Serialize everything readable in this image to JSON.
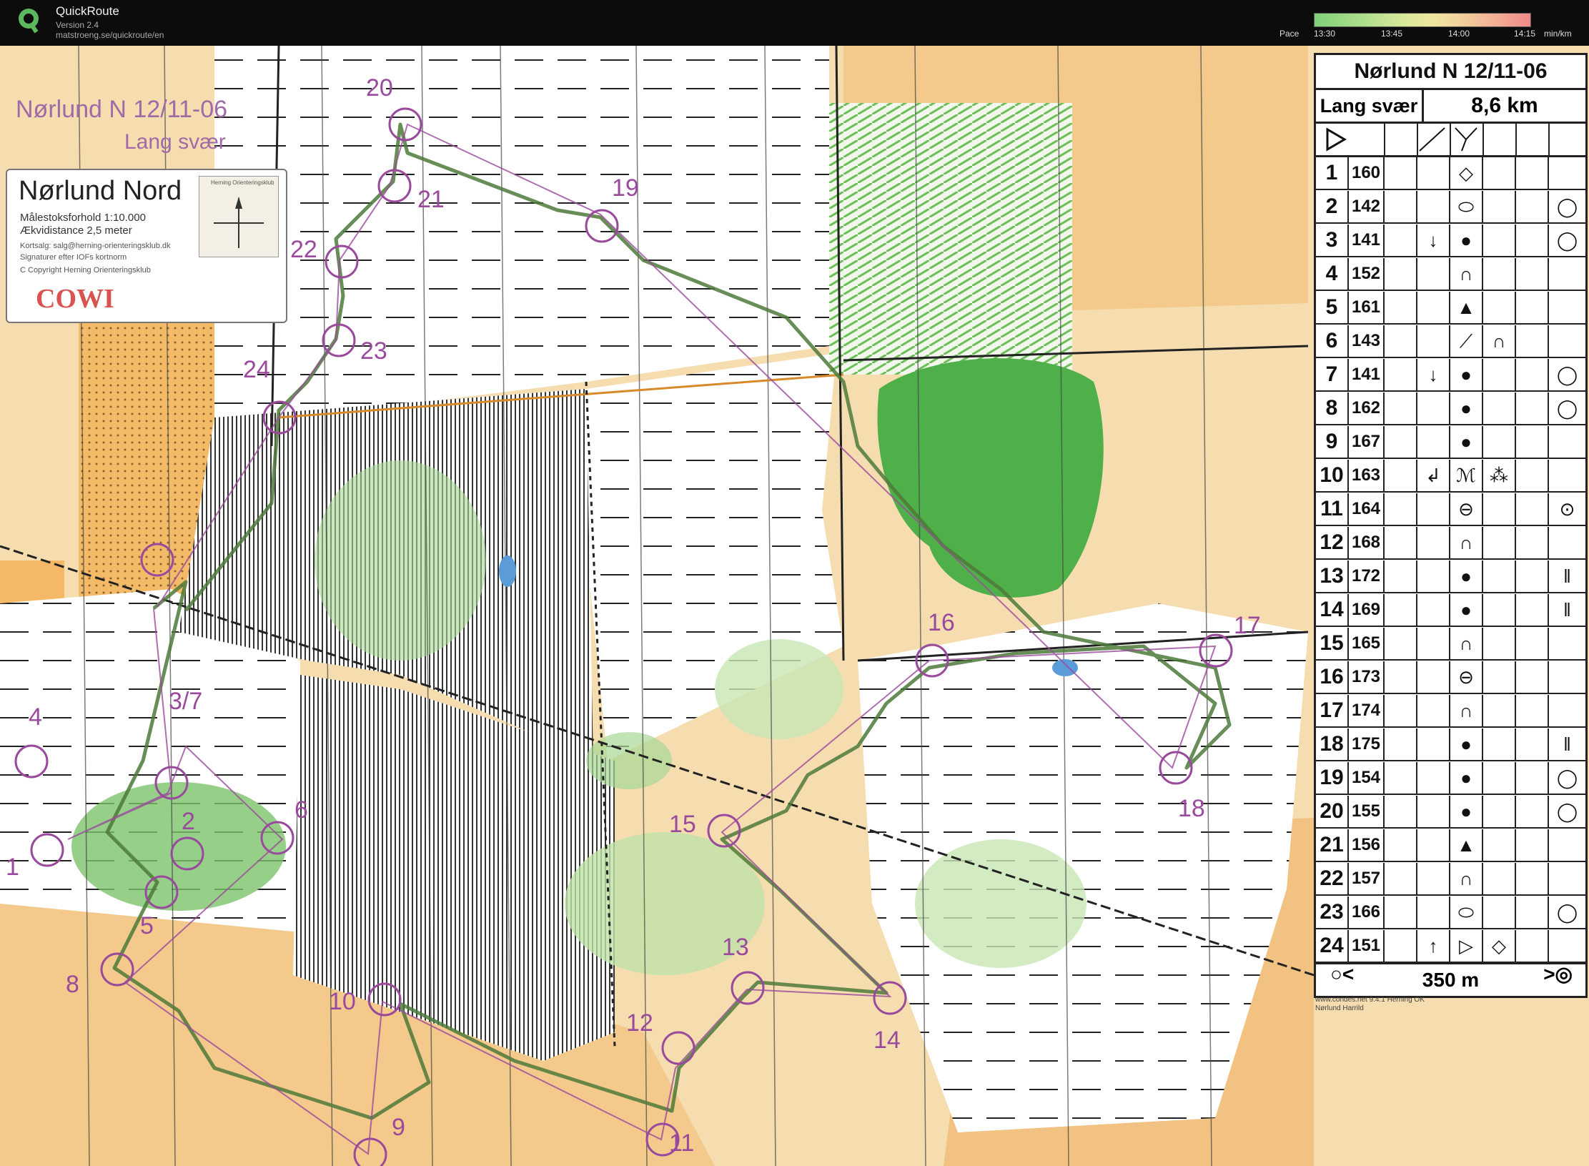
{
  "app": {
    "title": "QuickRoute",
    "version": "Version 2.4",
    "url": "matstroeng.se/quickroute/en",
    "pace_label": "Pace",
    "pace_ticks": [
      "13:30",
      "13:45",
      "14:00",
      "14:15"
    ],
    "pace_unit": "min/km"
  },
  "map": {
    "heading": "Nørlund N 12/11-06",
    "course": "Lang svær",
    "legend": {
      "title": "Nørlund Nord",
      "lines": [
        "Målestoksforhold 1:10.000",
        "Ækvidistance 2,5 meter"
      ],
      "small": [
        "Kortsalg: salg@herning-orienteringsklub.dk",
        "Signaturer efter IOFs kortnorm",
        "C Copyright Herning Orienteringsklub"
      ],
      "thumb_label": "Herning Orienteringsklub",
      "brand": "COWI"
    },
    "control_numbers": [
      "1",
      "2",
      "3/7",
      "4",
      "5",
      "6",
      "8",
      "9",
      "10",
      "11",
      "12",
      "13",
      "14",
      "15",
      "16",
      "17",
      "18",
      "19",
      "20",
      "21",
      "22",
      "23",
      "24"
    ]
  },
  "description": {
    "title": "Nørlund N 12/11-06",
    "class": "Lang svær",
    "length": "8,6 km",
    "start_symbols": [
      "start-triangle-icon",
      "path-crossing-icon"
    ],
    "rows": [
      {
        "seq": "1",
        "code": "160",
        "dir": "",
        "feature": "◇",
        "extra": "",
        "pos": ""
      },
      {
        "seq": "2",
        "code": "142",
        "dir": "",
        "feature": "⬭",
        "extra": "",
        "pos": "◯"
      },
      {
        "seq": "3",
        "code": "141",
        "dir": "↓",
        "feature": "●",
        "extra": "",
        "pos": "◯"
      },
      {
        "seq": "4",
        "code": "152",
        "dir": "",
        "feature": "∩",
        "extra": "",
        "pos": ""
      },
      {
        "seq": "5",
        "code": "161",
        "dir": "",
        "feature": "▲",
        "extra": "",
        "pos": ""
      },
      {
        "seq": "6",
        "code": "143",
        "dir": "",
        "feature": "⟋",
        "extra": "∩",
        "pos": ""
      },
      {
        "seq": "7",
        "code": "141",
        "dir": "↓",
        "feature": "●",
        "extra": "",
        "pos": "◯"
      },
      {
        "seq": "8",
        "code": "162",
        "dir": "",
        "feature": "●",
        "extra": "",
        "pos": "◯"
      },
      {
        "seq": "9",
        "code": "167",
        "dir": "",
        "feature": "●",
        "extra": "",
        "pos": ""
      },
      {
        "seq": "10",
        "code": "163",
        "dir": "↲",
        "feature": "ℳ",
        "extra": "⁂",
        "pos": ""
      },
      {
        "seq": "11",
        "code": "164",
        "dir": "",
        "feature": "⊖",
        "extra": "",
        "pos": "⊙"
      },
      {
        "seq": "12",
        "code": "168",
        "dir": "",
        "feature": "∩",
        "extra": "",
        "pos": ""
      },
      {
        "seq": "13",
        "code": "172",
        "dir": "",
        "feature": "●",
        "extra": "",
        "pos": "‖"
      },
      {
        "seq": "14",
        "code": "169",
        "dir": "",
        "feature": "●",
        "extra": "",
        "pos": "‖"
      },
      {
        "seq": "15",
        "code": "165",
        "dir": "",
        "feature": "∩",
        "extra": "",
        "pos": ""
      },
      {
        "seq": "16",
        "code": "173",
        "dir": "",
        "feature": "⊖",
        "extra": "",
        "pos": ""
      },
      {
        "seq": "17",
        "code": "174",
        "dir": "",
        "feature": "∩",
        "extra": "",
        "pos": ""
      },
      {
        "seq": "18",
        "code": "175",
        "dir": "",
        "feature": "●",
        "extra": "",
        "pos": "‖"
      },
      {
        "seq": "19",
        "code": "154",
        "dir": "",
        "feature": "●",
        "extra": "",
        "pos": "◯"
      },
      {
        "seq": "20",
        "code": "155",
        "dir": "",
        "feature": "●",
        "extra": "",
        "pos": "◯"
      },
      {
        "seq": "21",
        "code": "156",
        "dir": "",
        "feature": "▲",
        "extra": "",
        "pos": ""
      },
      {
        "seq": "22",
        "code": "157",
        "dir": "",
        "feature": "∩",
        "extra": "",
        "pos": ""
      },
      {
        "seq": "23",
        "code": "166",
        "dir": "",
        "feature": "⬭",
        "extra": "",
        "pos": "◯"
      },
      {
        "seq": "24",
        "code": "151",
        "dir": "↑",
        "feature": "▷",
        "extra": "◇",
        "pos": ""
      }
    ],
    "footer_distance": "350 m",
    "footer_left": "○<",
    "footer_right": ">◎",
    "credit1": "www.condes.net 9.4.1 Herning OK",
    "credit2": "Nørlund Harrild"
  },
  "colors": {
    "route": "#4d7a3a",
    "controls": "#9a4a9c",
    "forest_green": "#4fb04a",
    "open_orange": "#f3b96a",
    "pace_fast": "#7fd07a",
    "pace_slow": "#f08a8a"
  }
}
